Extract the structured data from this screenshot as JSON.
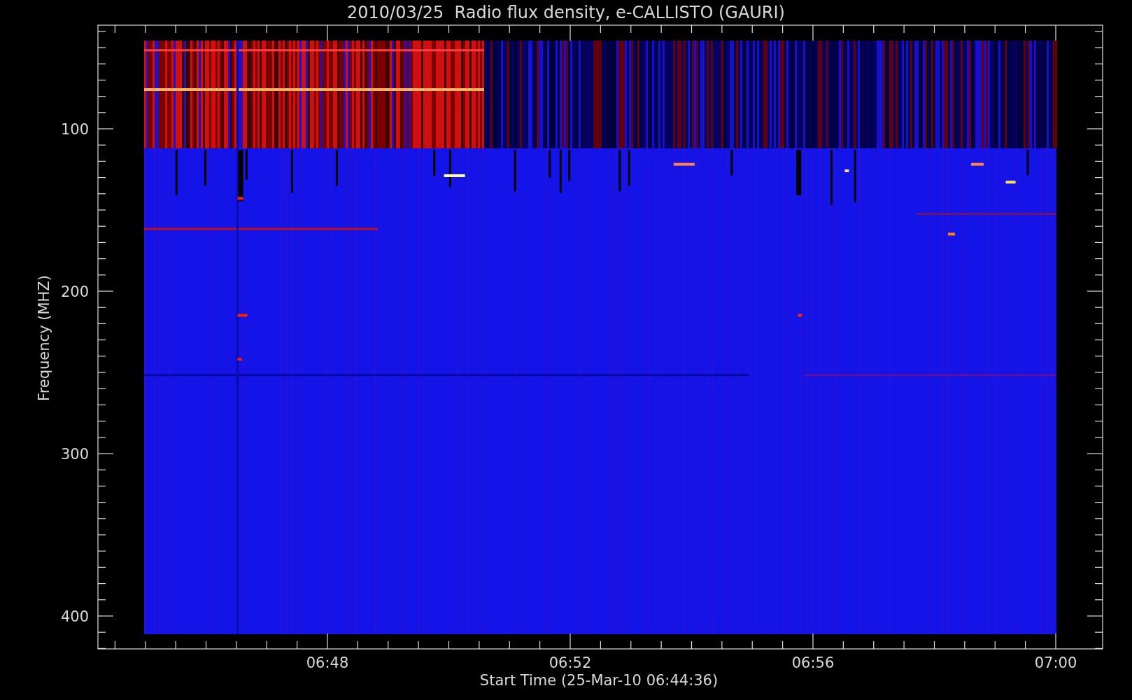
{
  "title": "2010/03/25  Radio flux density, e-CALLISTO (GAURI)",
  "y_axis": {
    "label": "Frequency (MHZ)",
    "ticks": [
      "100",
      "200",
      "300",
      "400"
    ]
  },
  "x_axis": {
    "label": "Start Time (25-Mar-10 06:44:36)",
    "ticks": [
      "06:48",
      "06:52",
      "06:56",
      "07:00"
    ]
  }
}
